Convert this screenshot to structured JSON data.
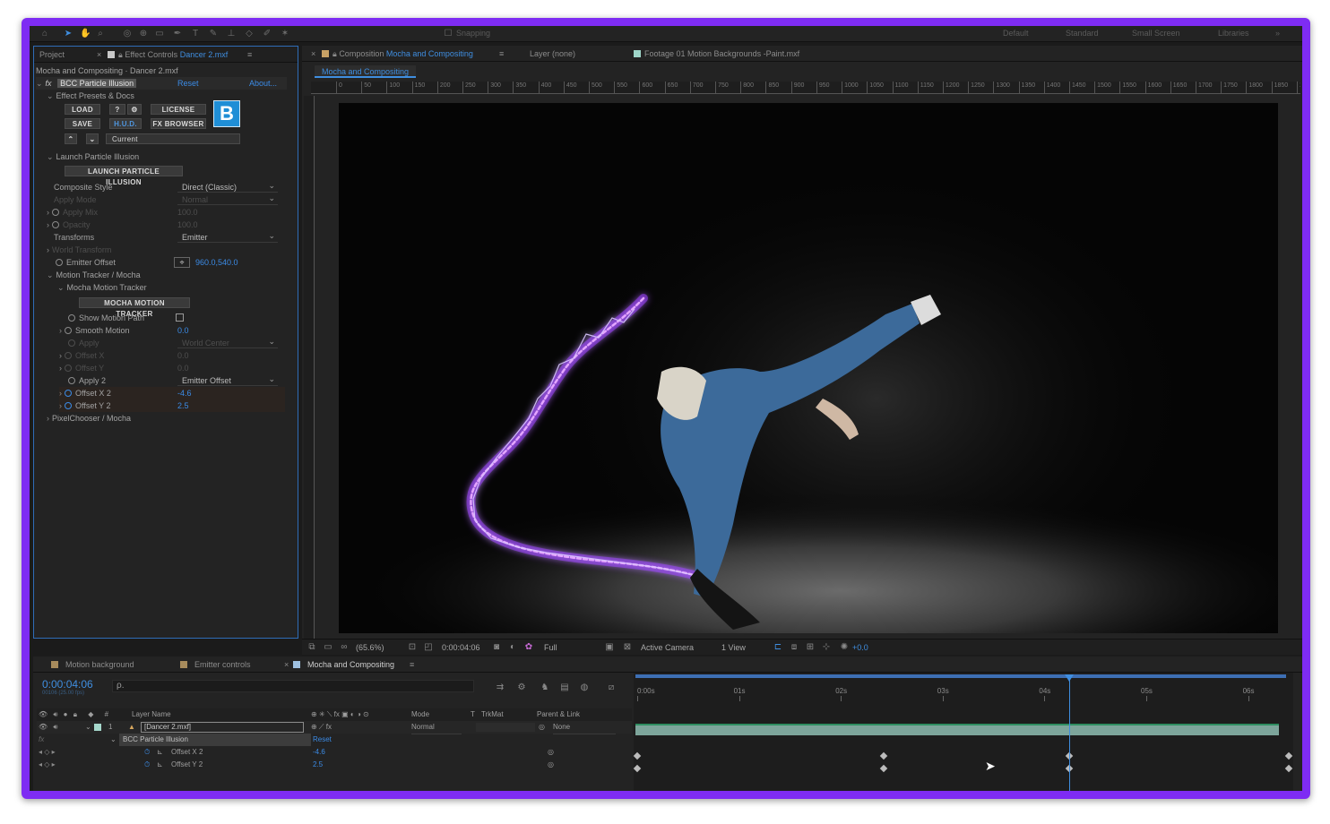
{
  "top_toolbar": {
    "snapping_label": "Snapping",
    "workspaces": [
      "Default",
      "Standard",
      "Small Screen",
      "Libraries"
    ]
  },
  "left_panel": {
    "tabs": {
      "project": "Project",
      "effect_controls_prefix": "Effect Controls",
      "effect_controls_layer": "Dancer 2.mxf"
    },
    "breadcrumb": "Mocha and Compositing · Dancer 2.mxf",
    "effect": {
      "fx": "fx",
      "name": "BCC Particle Illusion",
      "reset": "Reset",
      "about": "About..."
    },
    "presets_section": "Effect Presets & Docs",
    "buttons": {
      "load": "LOAD",
      "help": "?",
      "license": "LICENSE",
      "save": "SAVE",
      "hud": "H.U.D.",
      "fx_browser": "FX BROWSER",
      "current": "Current"
    },
    "logo_letter": "B",
    "launch_section": "Launch Particle Illusion",
    "launch_button": "LAUNCH PARTICLE ILLUSION",
    "composite_style": {
      "label": "Composite Style",
      "value": "Direct (Classic)"
    },
    "apply_mode": {
      "label": "Apply Mode",
      "value": "Normal"
    },
    "apply_mix": {
      "label": "Apply Mix",
      "value": "100.0"
    },
    "opacity": {
      "label": "Opacity",
      "value": "100.0"
    },
    "transforms": {
      "label": "Transforms",
      "value": "Emitter"
    },
    "world_transform": "World Transform",
    "emitter_offset": {
      "label": "Emitter Offset",
      "value": "960.0,540.0"
    },
    "motion_tracker_section": "Motion Tracker / Mocha",
    "mocha_motion_tracker_section": "Mocha Motion Tracker",
    "mocha_button": "MOCHA MOTION TRACKER",
    "show_motion_path": "Show Motion Path",
    "smooth_motion": {
      "label": "Smooth Motion",
      "value": "0.0"
    },
    "apply": {
      "label": "Apply",
      "value": "World Center"
    },
    "offset_x": {
      "label": "Offset X",
      "value": "0.0"
    },
    "offset_y": {
      "label": "Offset Y",
      "value": "0.0"
    },
    "apply_2": {
      "label": "Apply 2",
      "value": "Emitter Offset"
    },
    "offset_x2": {
      "label": "Offset X 2",
      "value": "-4.6"
    },
    "offset_y2": {
      "label": "Offset Y 2",
      "value": "2.5"
    },
    "pixelchooser_section": "PixelChooser / Mocha"
  },
  "comp_panel": {
    "tab_composition_prefix": "Composition",
    "tab_composition_name": "Mocha and Compositing",
    "tab_layer": "Layer (none)",
    "tab_footage": "Footage 01 Motion Backgrounds -Paint.mxf",
    "subtab": "Mocha and Compositing",
    "ruler_ticks": [
      "0",
      "50",
      "100",
      "150",
      "200",
      "250",
      "300",
      "350",
      "400",
      "450",
      "500",
      "550",
      "600",
      "650",
      "700",
      "750",
      "800",
      "850",
      "900",
      "950",
      "1000",
      "1050",
      "1100",
      "1150",
      "1200",
      "1250",
      "1300",
      "1350",
      "1400",
      "1450",
      "1500",
      "1550",
      "1600",
      "1650",
      "1700",
      "1750",
      "1800",
      "1850",
      "1900"
    ],
    "footer": {
      "zoom": "(65.6%)",
      "timecode": "0:00:04:06",
      "resolution": "Full",
      "camera": "Active Camera",
      "view": "1 View",
      "exposure": "+0.0"
    }
  },
  "timeline": {
    "tabs": [
      "Motion background",
      "Emitter controls",
      "Mocha and Compositing"
    ],
    "tab_colors": [
      "#a78b5c",
      "#a78b5c",
      "#9ec0e0"
    ],
    "timecode": "0:00:04:06",
    "fps": "00106 (25.00 fps)",
    "search_placeholder": "ρ.",
    "columns": {
      "layer_name": "Layer Name",
      "mode": "Mode",
      "t": "T",
      "trkmat": "TrkMat",
      "parent_link": "Parent & Link"
    },
    "layer": {
      "index": "1",
      "name": "[Dancer 2.mxf]",
      "mode": "Normal",
      "parent": "None"
    },
    "effect_row": {
      "fx": "fx",
      "name": "BCC Particle Illusion",
      "reset": "Reset"
    },
    "prop_rows": [
      {
        "label": "Offset X 2",
        "value": "-4.6"
      },
      {
        "label": "Offset Y 2",
        "value": "2.5"
      }
    ],
    "time_labels": [
      "0:00s",
      "01s",
      "02s",
      "03s",
      "04s",
      "05s",
      "06s"
    ],
    "current_time_s": 4.24,
    "keyframe_times_s": [
      0,
      2.42,
      4.24,
      6.4
    ]
  },
  "colors": {
    "frame_border": "#7e2cf3",
    "accent_blue": "#3f8ee0",
    "layer_bar": "#7da59b",
    "particle_glow": "#b24bff"
  }
}
